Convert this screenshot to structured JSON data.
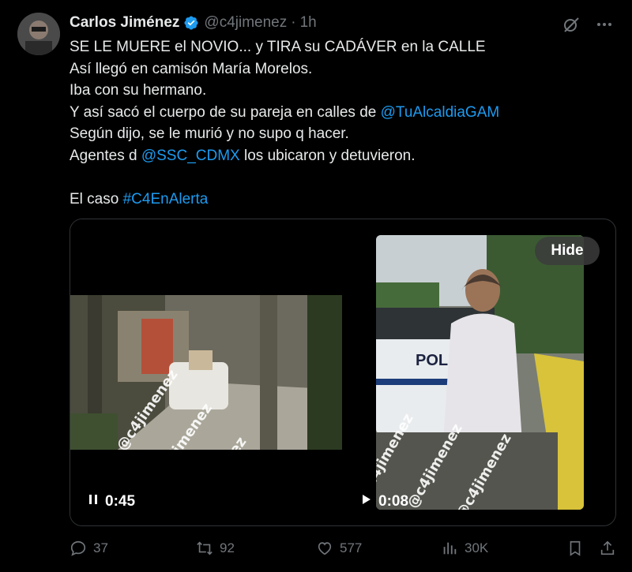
{
  "author": {
    "name": "Carlos Jiménez",
    "handle": "@c4jimenez",
    "separator": "·",
    "time": "1h"
  },
  "tweet": {
    "lines": [
      "SE LE MUERE el NOVIO... y TIRA su CADÁVER en la CALLE",
      "Así llegó en camisón María Morelos.",
      "Iba con su hermano.",
      "Y así sacó el cuerpo de su pareja en calles de ",
      "Según dijo, se le murió y no supo q hacer.",
      "Agentes d ",
      " los ubicaron y detuvieron.",
      "El caso "
    ],
    "mention_gam": "@TuAlcaldiaGAM",
    "mention_ssc": "@SSC_CDMX",
    "hashtag": "#C4EnAlerta"
  },
  "media": {
    "video1_duration": "0:45",
    "video2_duration": "0:08",
    "hide_label": "Hide",
    "watermark": "@c4jimenez",
    "police_text": "POLI"
  },
  "actions": {
    "replies": "37",
    "reposts": "92",
    "likes": "577",
    "views": "30K"
  },
  "colors": {
    "link": "#1d9bf0",
    "muted": "#71767b",
    "verified": "#1d9bf0"
  }
}
